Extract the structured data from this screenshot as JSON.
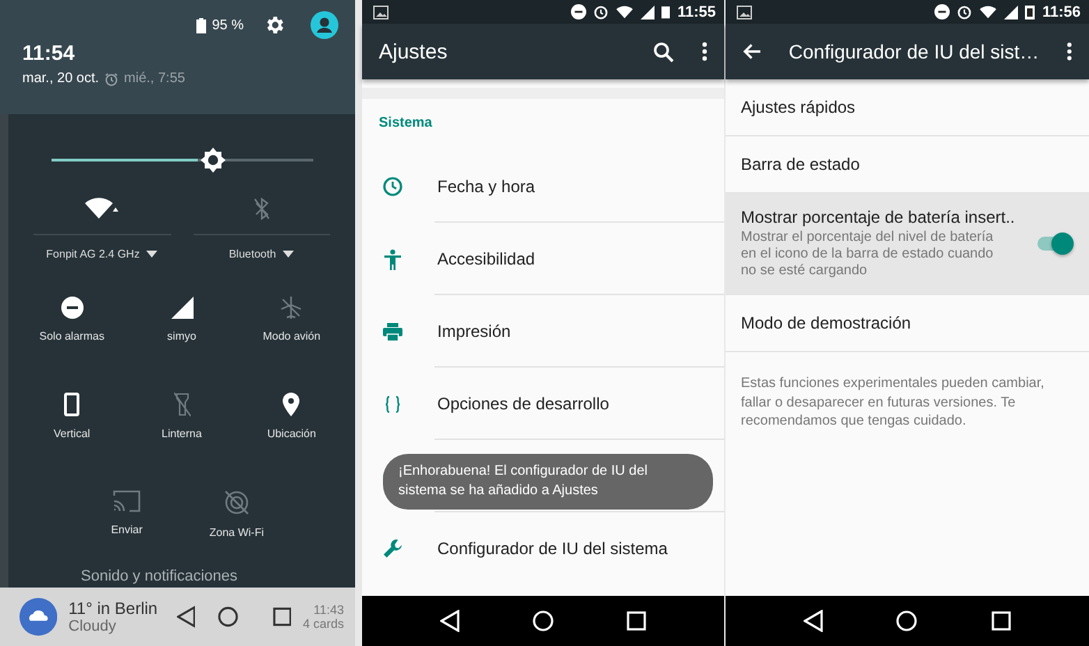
{
  "notification_shade": {
    "battery": "95 %",
    "time": "11:54",
    "date": "mar., 20 oct.",
    "alarm": "mié., 7:55",
    "brightness": {
      "level": 0.56
    },
    "wide_tiles": [
      {
        "label": "Fonpit AG 2.4 GHz",
        "on": true
      },
      {
        "label": "Bluetooth",
        "on": false
      }
    ],
    "tiles": [
      {
        "label": "Solo alarmas",
        "on": true
      },
      {
        "label": "simyo",
        "on": true
      },
      {
        "label": "Modo avión",
        "on": false
      },
      {
        "label": "Vertical",
        "on": true
      },
      {
        "label": "Linterna",
        "on": false
      },
      {
        "label": "Ubicación",
        "on": true
      },
      {
        "label": "Enviar",
        "on": false
      },
      {
        "label": "Zona Wi-Fi",
        "on": false
      }
    ],
    "behind_text": "Sonido y notificaciones",
    "card": {
      "title": "11° in Berlin",
      "subtitle": "Cloudy",
      "time": "11:43",
      "count": "4 cards"
    }
  },
  "settings_screen": {
    "status_time": "11:55",
    "title": "Ajustes",
    "section": "Sistema",
    "items": [
      {
        "kind": "item",
        "label": "Fecha y hora"
      },
      {
        "kind": "item",
        "label": "Accesibilidad"
      },
      {
        "kind": "item",
        "label": "Impresión"
      },
      {
        "kind": "item",
        "label": "Opciones de desarrollo"
      },
      {
        "kind": "covered"
      },
      {
        "kind": "item",
        "label": "Configurador de IU del sistema"
      }
    ],
    "toast": "¡Enhorabuena! El configurador de IU del sistema se ha añadido a Ajustes"
  },
  "tuner_screen": {
    "status_time": "11:56",
    "title": "Configurador de IU del sist…",
    "items": [
      {
        "kind": "plain",
        "title": "Ajustes rápidos"
      },
      {
        "kind": "plain",
        "title": "Barra de estado"
      },
      {
        "kind": "switch",
        "title": "Mostrar porcentaje de batería insert..",
        "subtitle": "Mostrar el porcentaje del nivel de batería en el icono de la barra de estado cuando no se esté cargando",
        "on": true
      },
      {
        "kind": "plain",
        "title": "Modo de demostración"
      }
    ],
    "footer": "Estas funciones experimentales pueden cambiar, fallar o desaparecer en futuras versiones. Te recomendamos que tengas cuidado."
  }
}
